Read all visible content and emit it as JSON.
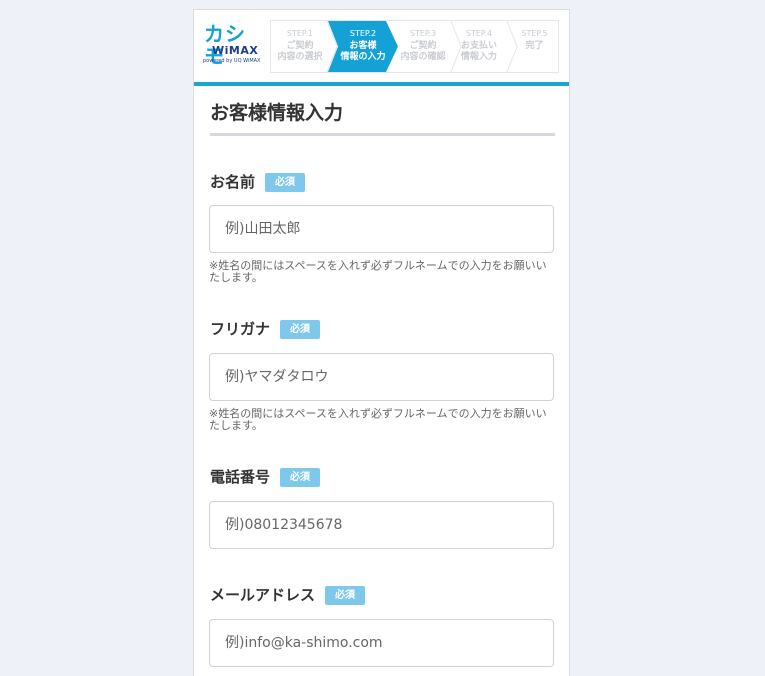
{
  "brand": {
    "logo_main": "カシモ",
    "logo_sub": "WiMAX",
    "logo_tiny": "powered by UQ WiMAX"
  },
  "steps": [
    {
      "num": "STEP.1",
      "line1": "ご契約",
      "line2": "内容の選択",
      "active": false
    },
    {
      "num": "STEP.2",
      "line1": "お客様",
      "line2": "情報の入力",
      "active": true
    },
    {
      "num": "STEP.3",
      "line1": "ご契約",
      "line2": "内容の確認",
      "active": false
    },
    {
      "num": "STEP.4",
      "line1": "お支払い",
      "line2": "情報入力",
      "active": false
    },
    {
      "num": "STEP.5",
      "line1": "完了",
      "line2": "",
      "active": false
    }
  ],
  "colors": {
    "accent": "#19a5cf",
    "step_active": "#14a2d6",
    "badge": "#7ec8ec",
    "background": "#eef1f8"
  },
  "form": {
    "title": "お客様情報入力",
    "required_badge": "必須",
    "fields": {
      "name": {
        "label": "お名前",
        "placeholder": "例)山田太郎",
        "note": "※姓名の間にはスペースを入れず必ずフルネームでの入力をお願いいたします。"
      },
      "furigana": {
        "label": "フリガナ",
        "placeholder": "例)ヤマダタロウ",
        "note": "※姓名の間にはスペースを入れず必ずフルネームでの入力をお願いいたします。"
      },
      "phone": {
        "label": "電話番号",
        "placeholder": "例)08012345678"
      },
      "email": {
        "label": "メールアドレス",
        "placeholder": "例)info@ka-shimo.com"
      }
    }
  }
}
